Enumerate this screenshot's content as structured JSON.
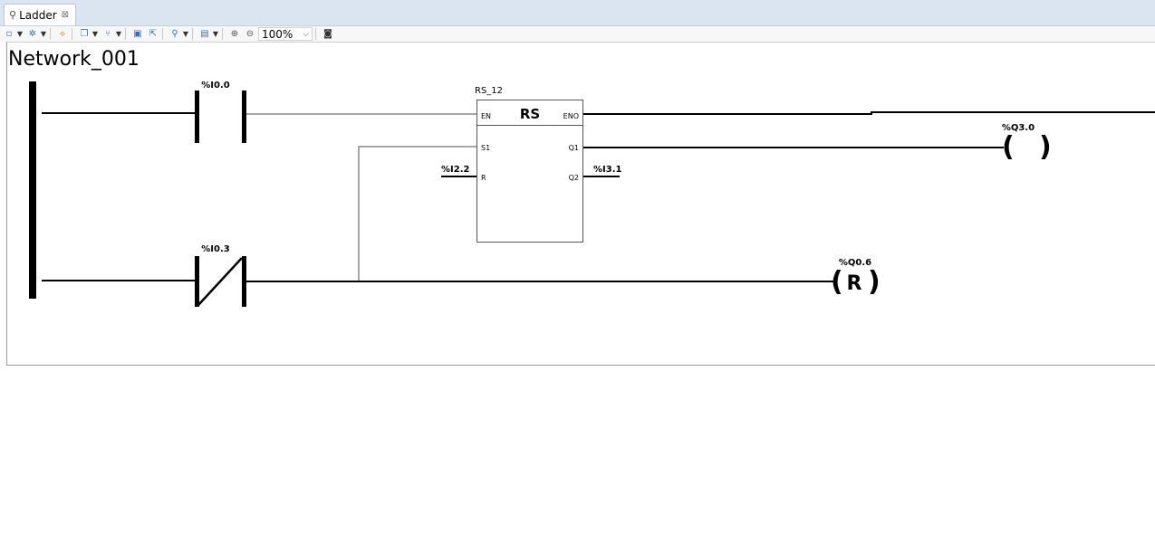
{
  "editor": {
    "tab_label": "Ladder",
    "tab_close": "⊠",
    "zoom_value": "100%"
  },
  "network": {
    "title": "Network_001",
    "contacts": [
      {
        "label": "%I0.0",
        "type": "normally-open"
      },
      {
        "label": "%I0.3",
        "type": "normally-closed"
      }
    ],
    "function_block": {
      "instance_name": "RS_12",
      "type_name": "RS",
      "inputs": [
        "EN",
        "S1",
        "R"
      ],
      "outputs": [
        "ENO",
        "Q1",
        "Q2"
      ],
      "r_variable": "%I2.2",
      "q2_variable": "%I3.1"
    },
    "coils": [
      {
        "label": "%Q3.0",
        "symbol": ""
      },
      {
        "label": "%Q0.6",
        "symbol": "R"
      }
    ]
  }
}
